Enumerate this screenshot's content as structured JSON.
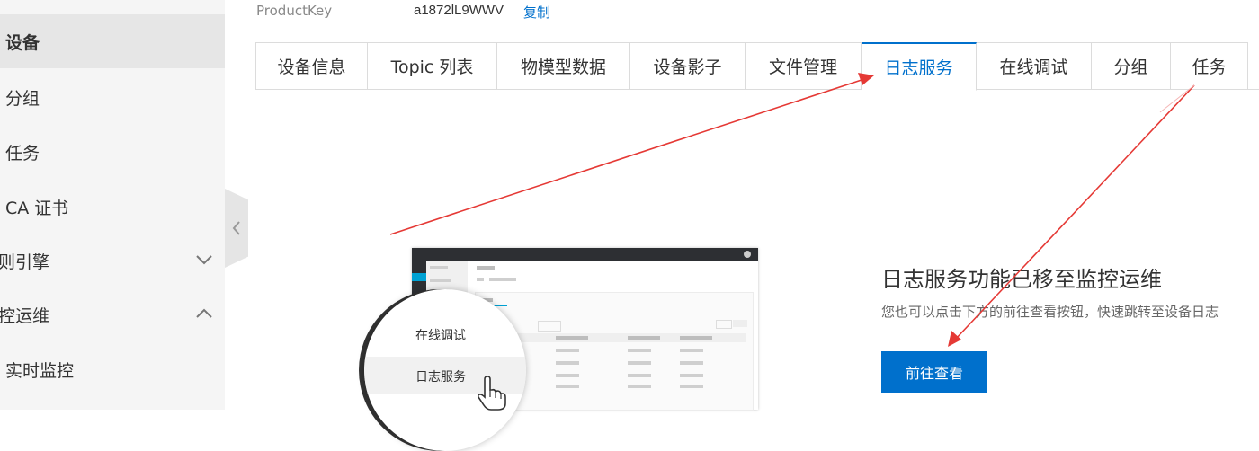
{
  "sidebar": {
    "items": [
      {
        "label": "设备",
        "active": true,
        "chevron": ""
      },
      {
        "label": "分组",
        "active": false,
        "chevron": ""
      },
      {
        "label": "任务",
        "active": false,
        "chevron": ""
      },
      {
        "label": "CA 证书",
        "active": false,
        "chevron": ""
      },
      {
        "label": "则引擎",
        "active": false,
        "chevron": "chevron-down-icon"
      },
      {
        "label": "控运维",
        "active": false,
        "chevron": "chevron-up-icon"
      },
      {
        "label": "实时监控",
        "active": false,
        "chevron": ""
      }
    ]
  },
  "header": {
    "product_key_label": "ProductKey",
    "product_key_value": "a1872lL9WWV",
    "copy_label": "复制"
  },
  "tabs": [
    {
      "label": "设备信息",
      "active": false
    },
    {
      "label": "Topic 列表",
      "active": false
    },
    {
      "label": "物模型数据",
      "active": false
    },
    {
      "label": "设备影子",
      "active": false
    },
    {
      "label": "文件管理",
      "active": false
    },
    {
      "label": "日志服务",
      "active": true
    },
    {
      "label": "在线调试",
      "active": false
    },
    {
      "label": "分组",
      "active": false
    },
    {
      "label": "任务",
      "active": false
    }
  ],
  "illustration": {
    "menu_item_1": "在线调试",
    "menu_item_2": "日志服务"
  },
  "info": {
    "title": "日志服务功能已移至监控运维",
    "description": "您也可以点击下方的前往查看按钮，快速跳转至设备日志",
    "button_label": "前往查看"
  },
  "colors": {
    "accent": "#0070cc",
    "annotation_arrow": "#e53935",
    "sidebar_bg": "#f5f5f5",
    "sidebar_active_bg": "#e6e6e6"
  }
}
